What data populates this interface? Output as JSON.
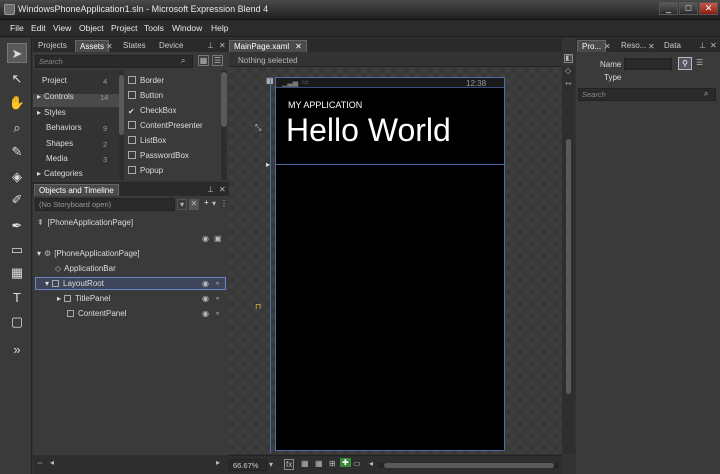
{
  "window": {
    "title": "WindowsPhoneApplication1.sln - Microsoft Expression Blend 4",
    "min": "_",
    "max": "□",
    "close": "✕"
  },
  "menu": [
    "File",
    "Edit",
    "View",
    "Object",
    "Project",
    "Tools",
    "Window",
    "Help"
  ],
  "left_tabs": {
    "projects": "Projects",
    "assets": "Assets",
    "states": "States",
    "device": "Device"
  },
  "assets": {
    "search_placeholder": "Search",
    "categories": [
      {
        "label": "Project",
        "count": "4"
      },
      {
        "label": "Controls",
        "count": "14"
      },
      {
        "label": "Styles",
        "count": ""
      },
      {
        "label": "Behaviors",
        "count": "9"
      },
      {
        "label": "Shapes",
        "count": "2"
      },
      {
        "label": "Media",
        "count": "3"
      },
      {
        "label": "Categories",
        "count": ""
      }
    ],
    "controls": [
      "Border",
      "Button",
      "CheckBox",
      "ContentPresenter",
      "ListBox",
      "PasswordBox",
      "Popup"
    ]
  },
  "objects": {
    "title": "Objects and Timeline",
    "storyboard": "(No Storyboard open)",
    "root": "[PhoneApplicationPage]",
    "tree": [
      "[PhoneApplicationPage]",
      "ApplicationBar",
      "LayoutRoot",
      "TitlePanel",
      "ContentPanel"
    ]
  },
  "doc": {
    "tab": "MainPage.xaml",
    "selection": "Nothing selected",
    "zoom": "66.67%"
  },
  "phone": {
    "time": "12:38",
    "app_title": "MY APPLICATION",
    "page_title": "Hello World"
  },
  "right_tabs": {
    "properties": "Pro...",
    "resources": "Reso...",
    "data": "Data"
  },
  "props": {
    "name_label": "Name",
    "type_label": "Type",
    "search_placeholder": "Search"
  },
  "colors": {
    "accent": "#4f6aa6",
    "selection": "#6a86c8"
  }
}
